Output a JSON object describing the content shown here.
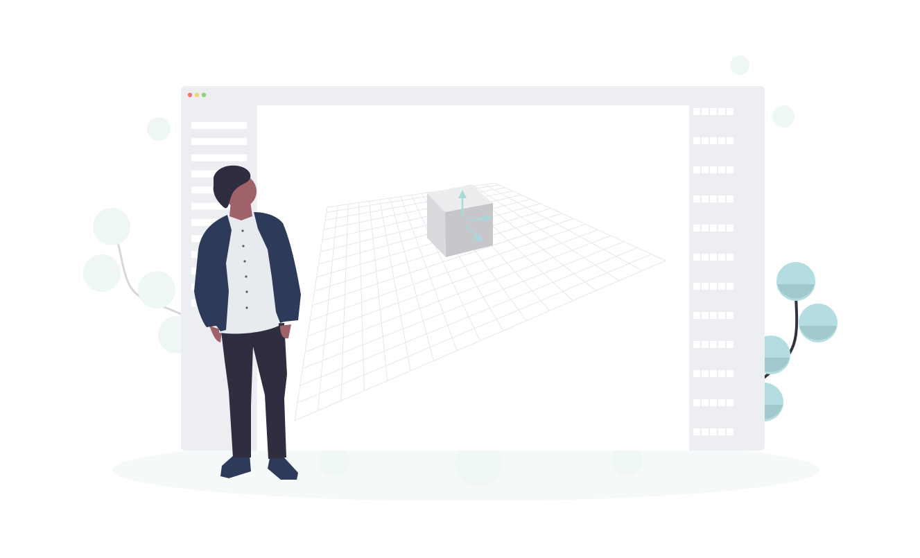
{
  "illustration": {
    "colors": {
      "window_frame": "#edeef2",
      "window_content": "#ffffff",
      "window_bar_line": "#ffffff",
      "dot_red": "#f17373",
      "dot_yellow": "#f2d46c",
      "dot_green": "#8ed07c",
      "grid_line": "#e6e7ea",
      "cube_top": "#ededf0",
      "cube_left": "#dadade",
      "cube_right": "#c6c6cb",
      "axis_arrow": "#a9d8dc",
      "ground": "#f6f9f9",
      "plant_faded": "#eef6f6",
      "plant_teal": "#b3dde0",
      "plant_teal_shade": "#a1c9cc",
      "stem_light": "#d7d7da",
      "stem_dark": "#33323f",
      "skin": "#9f616a",
      "hair": "#2f2e41",
      "jacket": "#2e3a59",
      "shirt": "#e7ebef",
      "pants": "#2f2e41",
      "shoes": "#2e3a59"
    },
    "window_controls": [
      "close-dot",
      "minimize-dot",
      "maximize-dot"
    ],
    "left_sidebar_rows": 12,
    "right_panel_rows": 12,
    "right_panel_cells_per_row": 5,
    "icons": [
      "cube-icon",
      "axis-arrows-icon",
      "perspective-grid",
      "person-figure",
      "plant-left",
      "plant-right"
    ]
  }
}
